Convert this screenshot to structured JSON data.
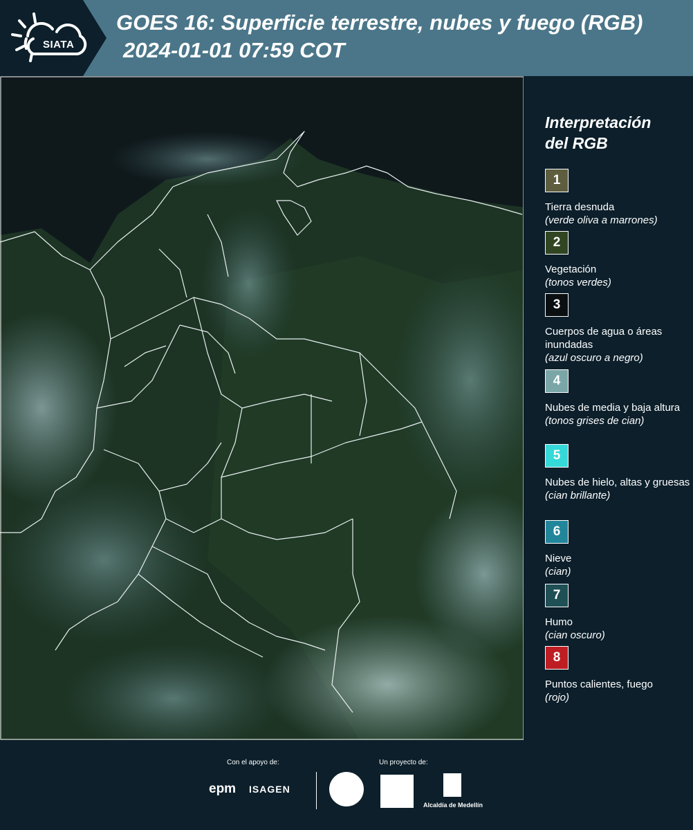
{
  "header": {
    "logo_text": "SIATA",
    "title": "GOES 16: Superficie terrestre, nubes y fuego (RGB)",
    "subtitle": "2024-01-01 07:59 COT"
  },
  "legend": {
    "title_line1": "Interpretación",
    "title_line2": "del RGB",
    "items": [
      {
        "number": "1",
        "label": "Tierra desnuda",
        "desc": "(verde oliva a marrones)",
        "color": "#5e5d3f"
      },
      {
        "number": "2",
        "label": "Vegetación",
        "desc": "(tonos verdes)",
        "color": "#324523"
      },
      {
        "number": "3",
        "label": "Cuerpos de agua o áreas inundadas",
        "desc": "(azul oscuro a negro)",
        "color": "#0a0f12"
      },
      {
        "number": "4",
        "label": "Nubes de media y baja altura",
        "desc": "(tonos grises de cian)",
        "color": "#7aa6a8"
      },
      {
        "number": "5",
        "label": "Nubes de hielo, altas y gruesas",
        "desc": "(cian brillante)",
        "color": "#35d9d8"
      },
      {
        "number": "6",
        "label": "Nieve",
        "desc": "(cian)",
        "color": "#22869b"
      },
      {
        "number": "7",
        "label": "Humo",
        "desc": "(cian oscuro)",
        "color": "#1e5055"
      },
      {
        "number": "8",
        "label": "Puntos calientes, fuego",
        "desc": "(rojo)",
        "color": "#be1e23"
      }
    ]
  },
  "footer": {
    "support_label": "Con el apoyo de:",
    "project_label": "Un proyecto de:",
    "epm": "epm",
    "isagen": "ISAGEN",
    "alcaldia": "Alcaldía de Medellín"
  }
}
